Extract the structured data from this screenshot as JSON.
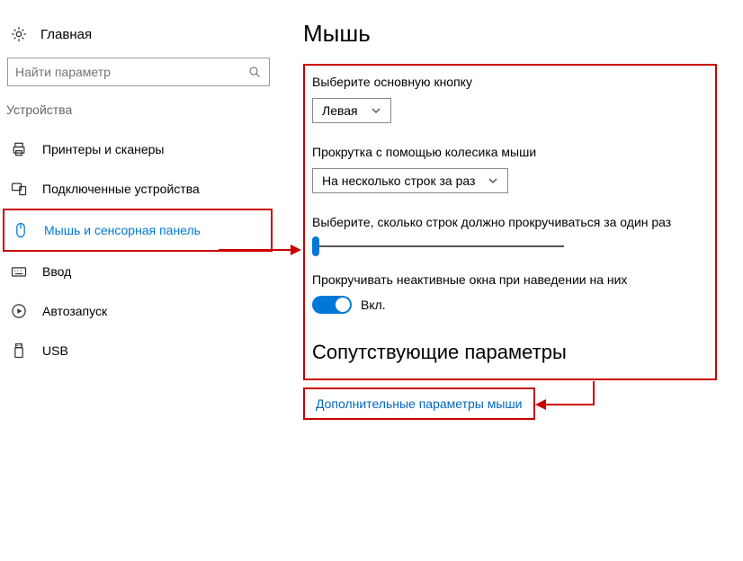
{
  "sidebar": {
    "home": "Главная",
    "search_placeholder": "Найти параметр",
    "section": "Устройства",
    "items": [
      {
        "label": "Принтеры и сканеры"
      },
      {
        "label": "Подключенные устройства"
      },
      {
        "label": "Мышь и сенсорная панель"
      },
      {
        "label": "Ввод"
      },
      {
        "label": "Автозапуск"
      },
      {
        "label": "USB"
      }
    ]
  },
  "main": {
    "title": "Мышь",
    "primary_button_label": "Выберите основную кнопку",
    "primary_button_value": "Левая",
    "scroll_label": "Прокрутка с помощью колесика мыши",
    "scroll_value": "На несколько строк за раз",
    "lines_label": "Выберите, сколько строк должно прокручиваться за один раз",
    "inactive_label": "Прокручивать неактивные окна при наведении на них",
    "toggle_text": "Вкл.",
    "related_heading": "Сопутствующие параметры",
    "extra_link": "Дополнительные параметры мыши"
  },
  "colors": {
    "accent": "#0078d7",
    "highlight": "#c00"
  }
}
